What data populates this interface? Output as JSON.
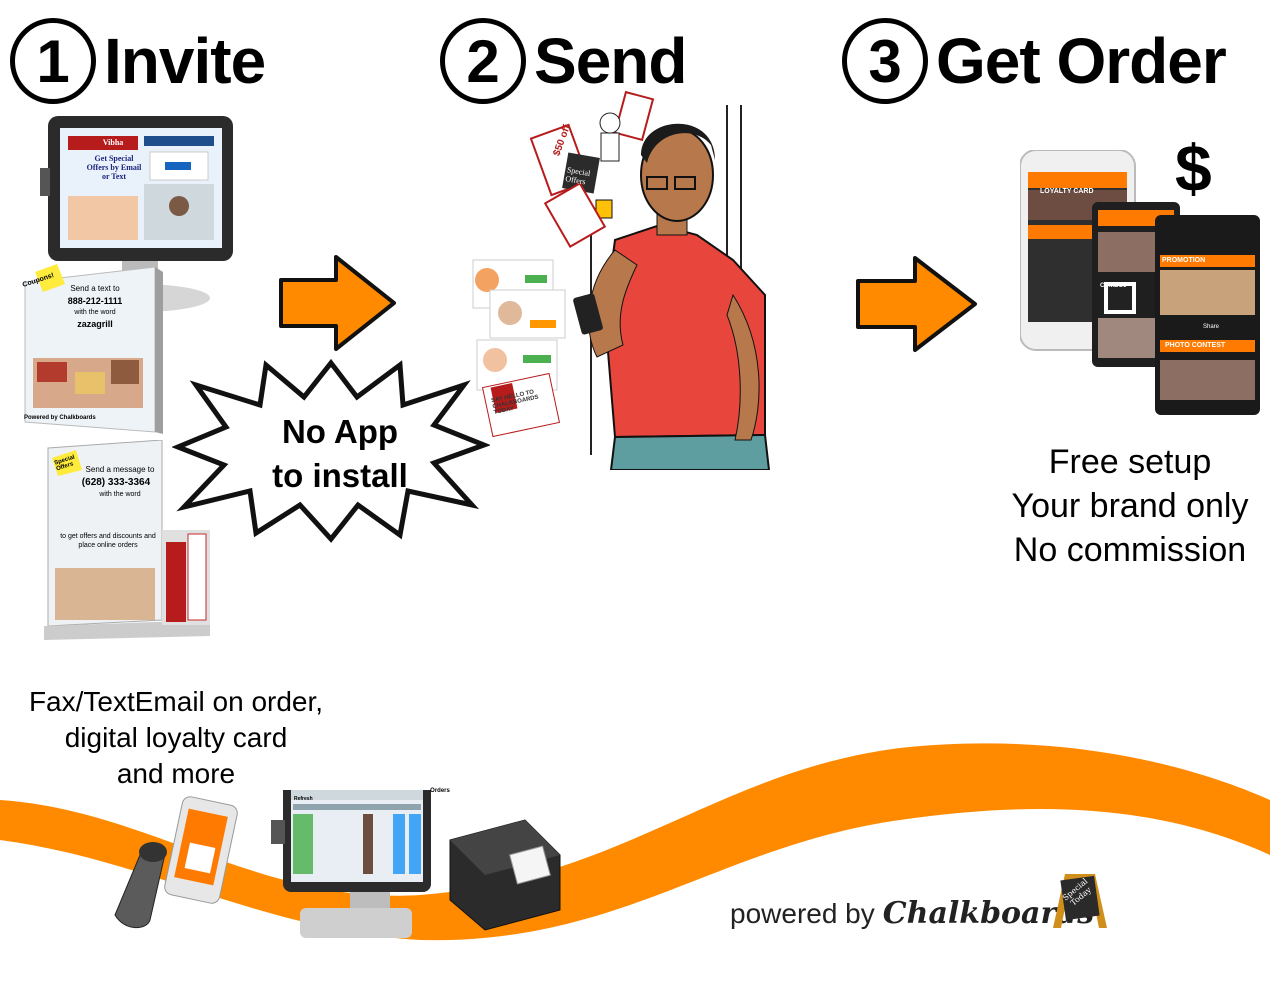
{
  "steps": [
    {
      "number": "1",
      "title": "Invite"
    },
    {
      "number": "2",
      "title": "Send"
    },
    {
      "number": "3",
      "title": "Get Order"
    }
  ],
  "burst": {
    "line1": "No App",
    "line2": "to install"
  },
  "benefits": [
    "Free setup",
    "Your brand only",
    "No commission"
  ],
  "currency_symbol": "$",
  "features": {
    "line1": "Fax/TextEmail  on order,",
    "line2": "digital loyalty card",
    "line3": "and more"
  },
  "branding": {
    "prefix": "powered by",
    "brand": "Chalkboards",
    "logo_text": "Special Today"
  },
  "kiosk_screen": {
    "brand": "Vibha",
    "text": "Get Special Offers by Email or Text"
  },
  "tent_card": {
    "badge": "Coupons!",
    "line1": "Send a text to",
    "number": "888-212-1111",
    "line2": "with the word",
    "keyword": "zazagrill",
    "footer": "Powered by Chalkboards"
  },
  "stand_card": {
    "badge": "Special Offers",
    "line1": "Send a message to",
    "number": "(628) 333-3364",
    "line2": "with the word",
    "line3": "to get offers and discounts and place online orders"
  },
  "coupons": {
    "c1": "$50 off",
    "c2": "Special Offers",
    "c3": "SAY HELLO TO CHALKBOARDS TODAY"
  },
  "phone_app": {
    "card1": "LOYALTY CARD",
    "card2": "PROMOTION",
    "card3": "PHOTO CONTEST",
    "combo": "COMBO1",
    "share": "Share"
  },
  "pos_screen": {
    "title": "Orders",
    "refresh": "Refresh"
  },
  "colors": {
    "orange": "#ff8a00",
    "shirt": "#e8453c",
    "arrow_outline": "#111111"
  }
}
